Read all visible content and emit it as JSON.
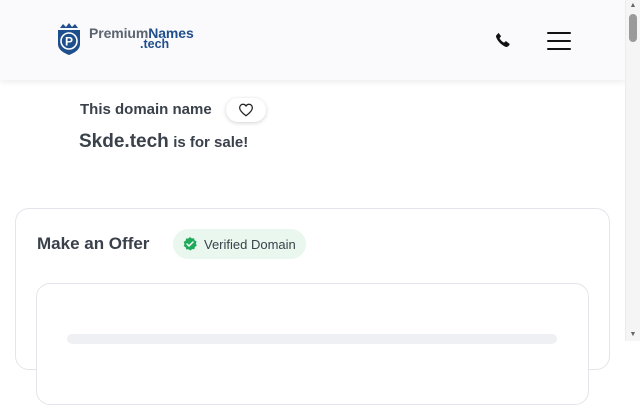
{
  "header": {
    "logo": {
      "main_plain": "Premium",
      "main_accent": "Names",
      "sub": ".tech",
      "badge_letter": "P"
    },
    "phone_icon": "phone-icon",
    "menu_icon": "hamburger-menu-icon"
  },
  "domain": {
    "intro": "This domain name",
    "name": "Skde.tech",
    "for_sale": "is for sale!",
    "favorite_icon": "heart-icon"
  },
  "offer": {
    "title": "Make an Offer",
    "verified_label": "Verified Domain",
    "verified_icon": "check-badge-icon"
  },
  "colors": {
    "brand": "#1f4e8c",
    "text": "#3a414b",
    "verified_bg": "#e9f7ef",
    "verified_icon": "#1faa59"
  }
}
